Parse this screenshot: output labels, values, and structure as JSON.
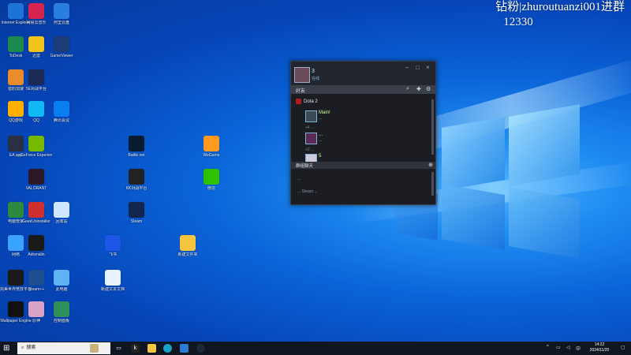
{
  "watermark": {
    "line1": "钻粉|zhuroutuanzi001进群",
    "line2": "12330"
  },
  "desktop_icons": [
    {
      "label": "Internet Explorer",
      "icon": "ie-icon",
      "color": "#1e73d8"
    },
    {
      "label": "网易云音乐",
      "icon": "music-icon",
      "color": "#d6234f"
    },
    {
      "label": "阿里云盘",
      "icon": "cloud-icon",
      "color": "#2a7de1"
    },
    {
      "label": "ToDesk",
      "icon": "todesk-icon",
      "color": "#1d8b4f"
    },
    {
      "label": "迅雷",
      "icon": "thunder-icon",
      "color": "#f2c31b"
    },
    {
      "label": "GameViewer",
      "icon": "gameviewer-icon",
      "color": "#1c3c78"
    },
    {
      "label": "猎豹加速",
      "icon": "boost-icon",
      "color": "#ea8c2b"
    },
    {
      "label": "5E对战平台",
      "icon": "5e-icon",
      "color": "#1a2a55"
    },
    {
      "label": "QQ游戏",
      "icon": "qqgame-icon",
      "color": "#ffb000"
    },
    {
      "label": "QQ",
      "icon": "qq-icon",
      "color": "#12b7f5"
    },
    {
      "label": "腾讯会议",
      "icon": "meeting-icon",
      "color": "#0a7ef0"
    },
    {
      "label": "EA app",
      "icon": "ea-icon",
      "color": "#2a3145"
    },
    {
      "label": "GeForce Experience",
      "icon": "nvidia-icon",
      "color": "#76b900"
    },
    {
      "label": "Battle.net",
      "icon": "battlenet-icon",
      "color": "#0b1b2f"
    },
    {
      "label": "WeGame",
      "icon": "wegame-icon",
      "color": "#ff9a1e"
    },
    {
      "label": "VALORANT",
      "icon": "valorant-icon",
      "color": "#2a1a28"
    },
    {
      "label": "KK对战平台",
      "icon": "kk-icon",
      "color": "#222222"
    },
    {
      "label": "微信",
      "icon": "wechat-icon",
      "color": "#2dc100"
    },
    {
      "label": "电脑管家",
      "icon": "guard-icon",
      "color": "#2b8a3e"
    },
    {
      "label": "GeekUninstaller",
      "icon": "geek-icon",
      "color": "#cf2f2f"
    },
    {
      "label": "回收站",
      "icon": "recycle-bin-icon",
      "color": "#cfe6ff"
    },
    {
      "label": "Steam",
      "icon": "steam-icon",
      "color": "#10264a"
    },
    {
      "label": "网络",
      "icon": "network-icon",
      "color": "#3aa3ff"
    },
    {
      "label": "Adrenalin",
      "icon": "amd-icon",
      "color": "#1a1a1a"
    },
    {
      "label": "飞书",
      "icon": "feishu-icon",
      "color": "#1e57e8"
    },
    {
      "label": "新建文件夹",
      "icon": "folder-icon",
      "color": "#f5c542"
    },
    {
      "label": "完美世界竞技平台",
      "icon": "perfect-icon",
      "color": "#1a1a1a"
    },
    {
      "label": "Steam++",
      "icon": "steampp-icon",
      "color": "#1c4d8f"
    },
    {
      "label": "此电脑",
      "icon": "this-pc-icon",
      "color": "#5fb3f5"
    },
    {
      "label": "新建文本文档",
      "icon": "textfile-icon",
      "color": "#e9f2ff"
    },
    {
      "label": "Wallpaper Engine",
      "icon": "wallpaper-icon",
      "color": "#111111"
    },
    {
      "label": "原神",
      "icon": "genshin-icon",
      "color": "#d9a3c7"
    },
    {
      "label": "控制面板",
      "icon": "control-panel-icon",
      "color": "#2f8f5b"
    }
  ],
  "steam": {
    "username": "3",
    "status": "在线",
    "friends_bar": "好友",
    "group": "Dota 2",
    "items": [
      {
        "name": "Main!",
        "game": "...",
        "sub": "+4 ..."
      },
      {
        "name": "...",
        "game": "...",
        "sub": "+2 ..."
      },
      {
        "name": "5",
        "game": "",
        "sub": ""
      }
    ],
    "chat_header": "群组聊天",
    "chat_lines": [
      "...",
      "... Steam ..."
    ]
  },
  "taskbar": {
    "search_placeholder": "搜索",
    "time": "14:22",
    "date": "2024/11/20"
  }
}
